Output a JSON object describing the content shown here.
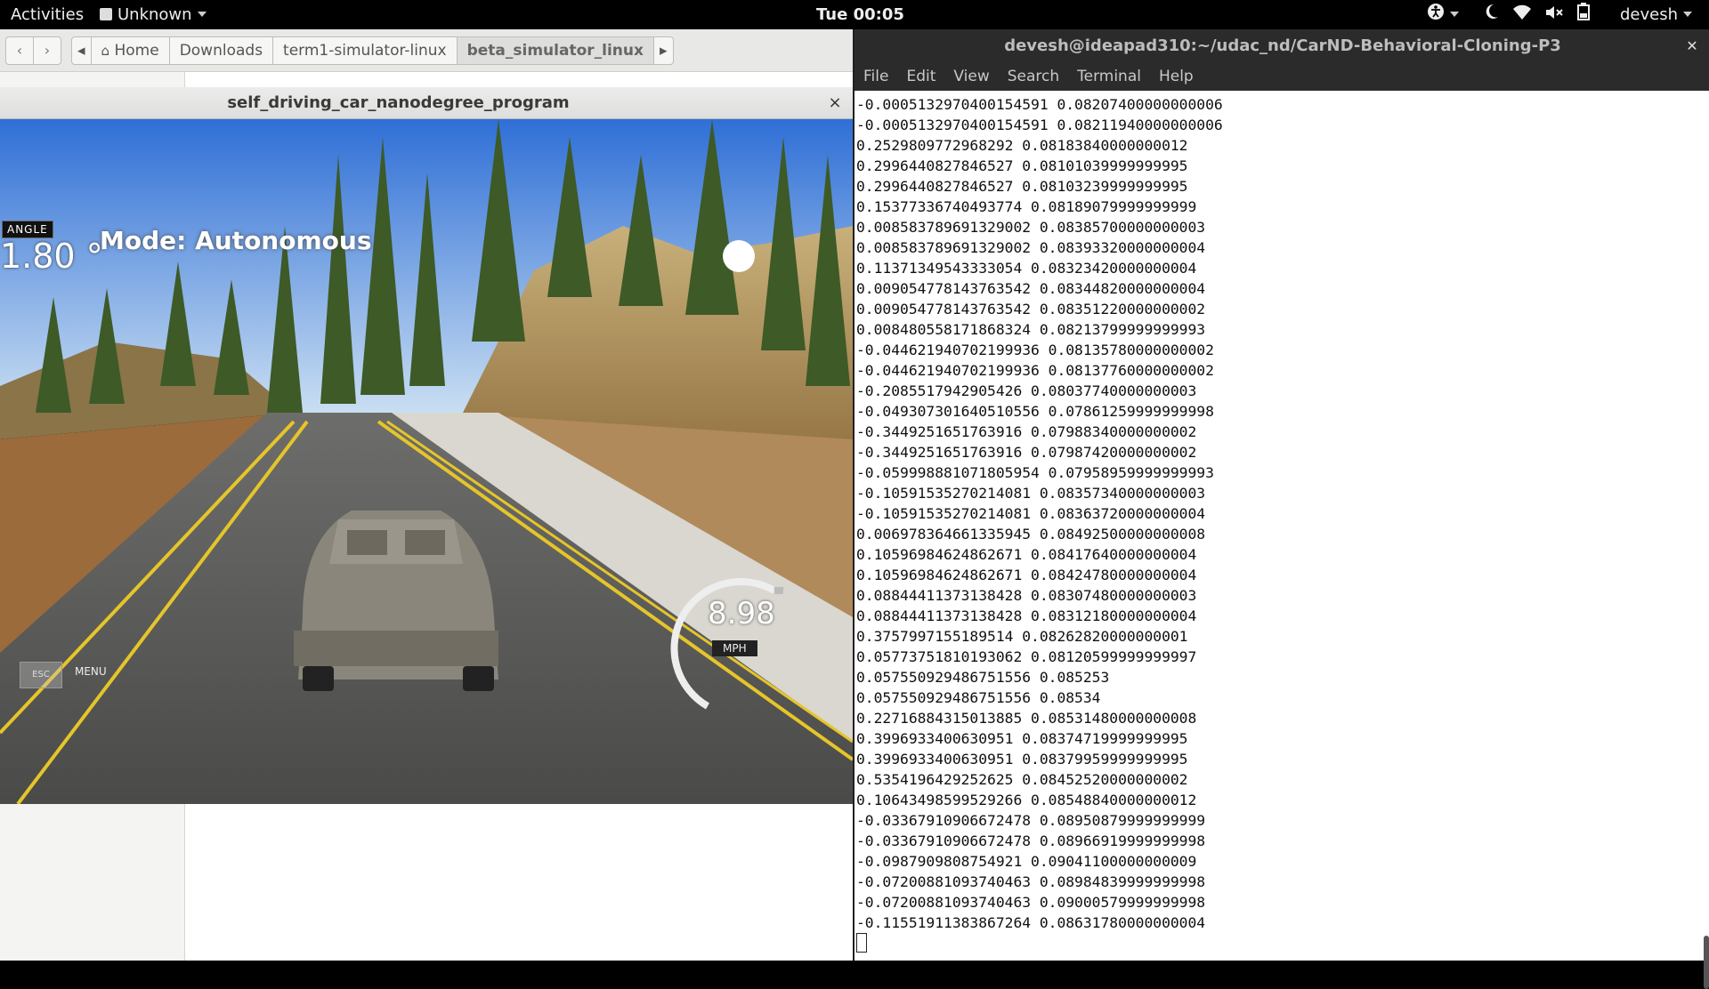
{
  "topbar": {
    "activities": "Activities",
    "app_menu": "Unknown",
    "clock": "Tue 00:05",
    "user": "devesh",
    "icons": [
      "accessibility-icon",
      "night-light-icon",
      "wifi-icon",
      "volume-muted-icon",
      "battery-icon"
    ]
  },
  "file_manager": {
    "path": [
      "Home",
      "Downloads",
      "term1-simulator-linux",
      "beta_simulator_linux"
    ]
  },
  "simulator": {
    "title": "self_driving_car_nanodegree_program",
    "angle_label": "ANGLE",
    "angle_value": "1.80 °",
    "mode": "Mode: Autonomous",
    "speed_value": "8.98",
    "speed_unit": "MPH",
    "esc_label": "ESC",
    "menu_label": "MENU"
  },
  "terminal": {
    "title": "devesh@ideapad310:~/udac_nd/CarND-Behavioral-Cloning-P3",
    "menu": [
      "File",
      "Edit",
      "View",
      "Search",
      "Terminal",
      "Help"
    ],
    "lines": [
      "-0.0005132970400154591 0.08207400000000006",
      "-0.0005132970400154591 0.08211940000000006",
      "0.2529809772968292 0.08183840000000012",
      "0.2996440827846527 0.08101039999999995",
      "0.2996440827846527 0.08103239999999995",
      "0.15377336740493774 0.08189079999999999",
      "0.008583789691329002 0.08385700000000003",
      "0.008583789691329002 0.08393320000000004",
      "0.11371349543333054 0.08323420000000004",
      "0.009054778143763542 0.08344820000000004",
      "0.009054778143763542 0.08351220000000002",
      "0.008480558171868324 0.08213799999999993",
      "-0.044621940702199936 0.08135780000000002",
      "-0.044621940702199936 0.08137760000000002",
      "-0.2085517942905426 0.08037740000000003",
      "-0.049307301640510556 0.07861259999999998",
      "-0.3449251651763916 0.07988340000000002",
      "-0.3449251651763916 0.07987420000000002",
      "-0.059998881071805954 0.07958959999999993",
      "-0.10591535270214081 0.08357340000000003",
      "-0.10591535270214081 0.08363720000000004",
      "0.006978364661335945 0.08492500000000008",
      "0.10596984624862671 0.08417640000000004",
      "0.10596984624862671 0.08424780000000004",
      "0.08844411373138428 0.08307480000000003",
      "0.08844411373138428 0.08312180000000004",
      "0.3757997155189514 0.08262820000000001",
      "0.05773751810193062 0.08120599999999997",
      "0.057550929486751556 0.085253",
      "0.057550929486751556 0.08534",
      "0.22716884315013885 0.08531480000000008",
      "0.3996933400630951 0.08374719999999995",
      "0.3996933400630951 0.08379959999999995",
      "0.5354196429252625 0.08452520000000002",
      "0.10643498599529266 0.08548840000000012",
      "-0.03367910906672478 0.08950879999999999",
      "-0.03367910906672478 0.08966919999999998",
      "-0.0987909808754921 0.09041100000000009",
      "-0.07200881093740463 0.08984839999999998",
      "-0.07200881093740463 0.09000579999999998",
      "-0.11551911383867264 0.08631780000000004"
    ]
  }
}
